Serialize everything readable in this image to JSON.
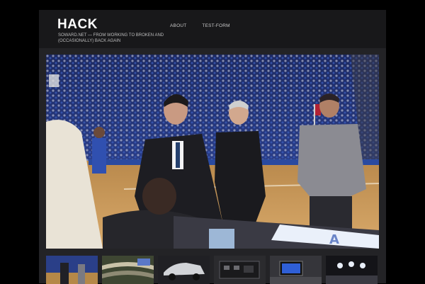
{
  "site": {
    "title": "HACK",
    "tagline": "SOWARD.NET — FROM WORKING TO BROKEN AND (OCCASIONALLY) BACK AGAIN"
  },
  "nav": {
    "items": [
      {
        "label": "ABOUT"
      },
      {
        "label": "TEST-FORM"
      }
    ]
  },
  "colors": {
    "page_background": "#000000",
    "shell_background": "#232326",
    "header_background": "#18181a",
    "title_text": "#ffffff",
    "nav_text": "#c9c9c9"
  },
  "featured_image": {
    "subject": "basketball courtside photo"
  },
  "thumbnails": [
    {
      "subject": "courtside crowd photo"
    },
    {
      "subject": "stadium seats photo"
    },
    {
      "subject": "car photo"
    },
    {
      "subject": "equipment panel photo"
    },
    {
      "subject": "monitor on desk photo"
    },
    {
      "subject": "stage lights photo"
    }
  ]
}
